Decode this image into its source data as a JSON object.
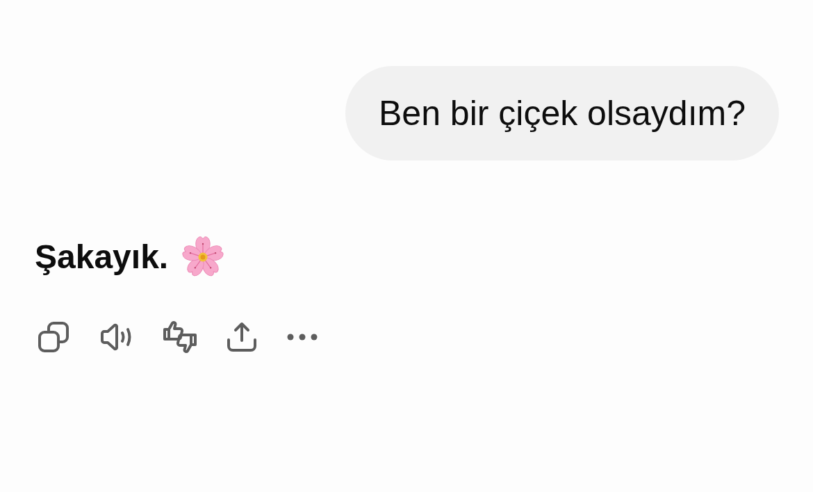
{
  "messages": [
    {
      "kind": "user",
      "text": "Ben bir çiçek olsaydım?"
    },
    {
      "kind": "assistant",
      "text": "Şakayık.",
      "actions": [
        {
          "kind": "copy"
        },
        {
          "kind": "speaker"
        },
        {
          "kind": "thumbs"
        },
        {
          "kind": "share"
        },
        {
          "kind": "more"
        }
      ]
    }
  ]
}
